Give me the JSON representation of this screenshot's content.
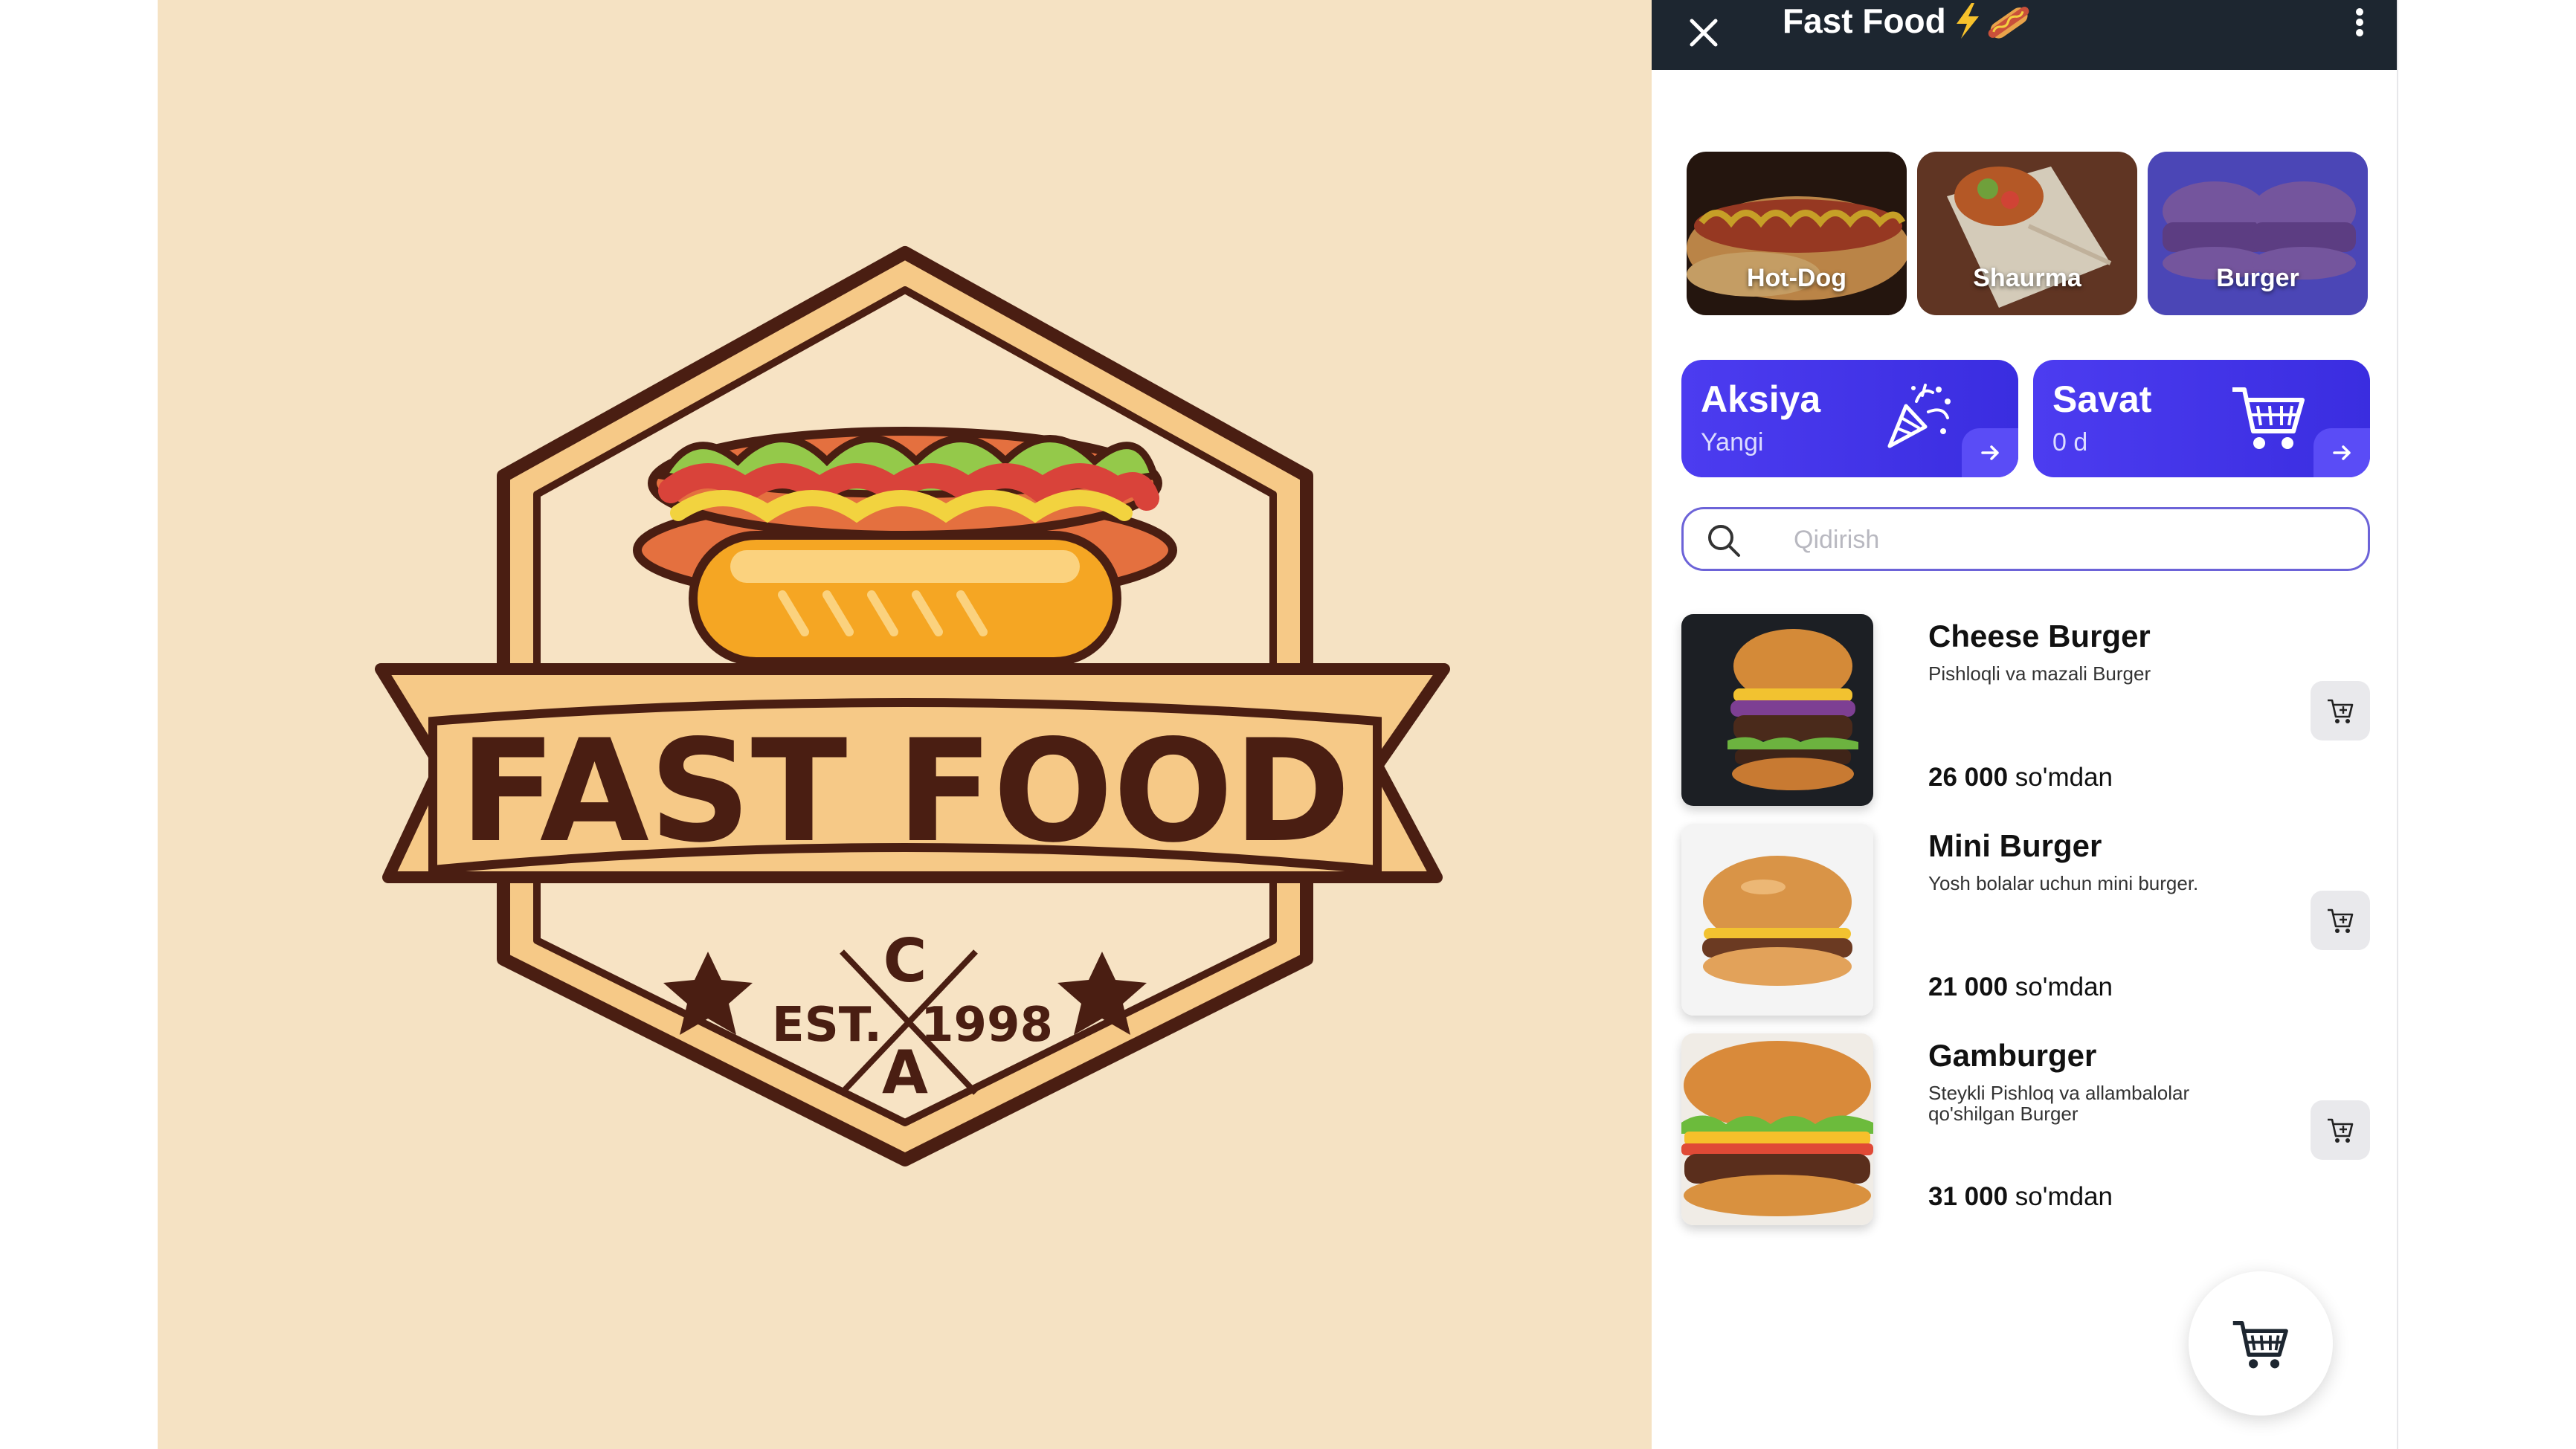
{
  "logo": {
    "main_text": "FAST FOOD",
    "est_label": "EST.",
    "year": "1998",
    "monogram_top": "C",
    "monogram_bottom": "A"
  },
  "app": {
    "title": "Fast Food",
    "title_icons": [
      "lightning-emoji",
      "hotdog-emoji"
    ],
    "close_icon": "close-icon",
    "menu_icon": "kebab-menu-icon"
  },
  "categories": [
    {
      "label": "Hot-Dog",
      "image": "hotdog-photo"
    },
    {
      "label": "Shaurma",
      "image": "shaurma-photo"
    },
    {
      "label": "Burger",
      "image": "burger-photo"
    }
  ],
  "promos": [
    {
      "title": "Aksiya",
      "subtitle": "Yangi",
      "icon": "party-popper-icon"
    },
    {
      "title": "Savat",
      "subtitle": "0 d",
      "icon": "shopping-cart-icon"
    }
  ],
  "search": {
    "placeholder": "Qidirish",
    "value": ""
  },
  "products": [
    {
      "name": "Cheese Burger",
      "description": "Pishloqli va mazali Burger",
      "price": "26 000",
      "price_suffix": "so'mdan"
    },
    {
      "name": "Mini Burger",
      "description": "Yosh bolalar uchun mini burger.",
      "price": "21 000",
      "price_suffix": "so'mdan"
    },
    {
      "name": "Gamburger",
      "description": "Steykli Pishloq va allambalolar qo'shilgan Burger",
      "price": "31 000",
      "price_suffix": "so'mdan"
    }
  ],
  "colors": {
    "topbar": "#1d2630",
    "accent": "#4c3cf0",
    "logo_background": "#f5e2c3",
    "logo_brown": "#4a1e12"
  }
}
